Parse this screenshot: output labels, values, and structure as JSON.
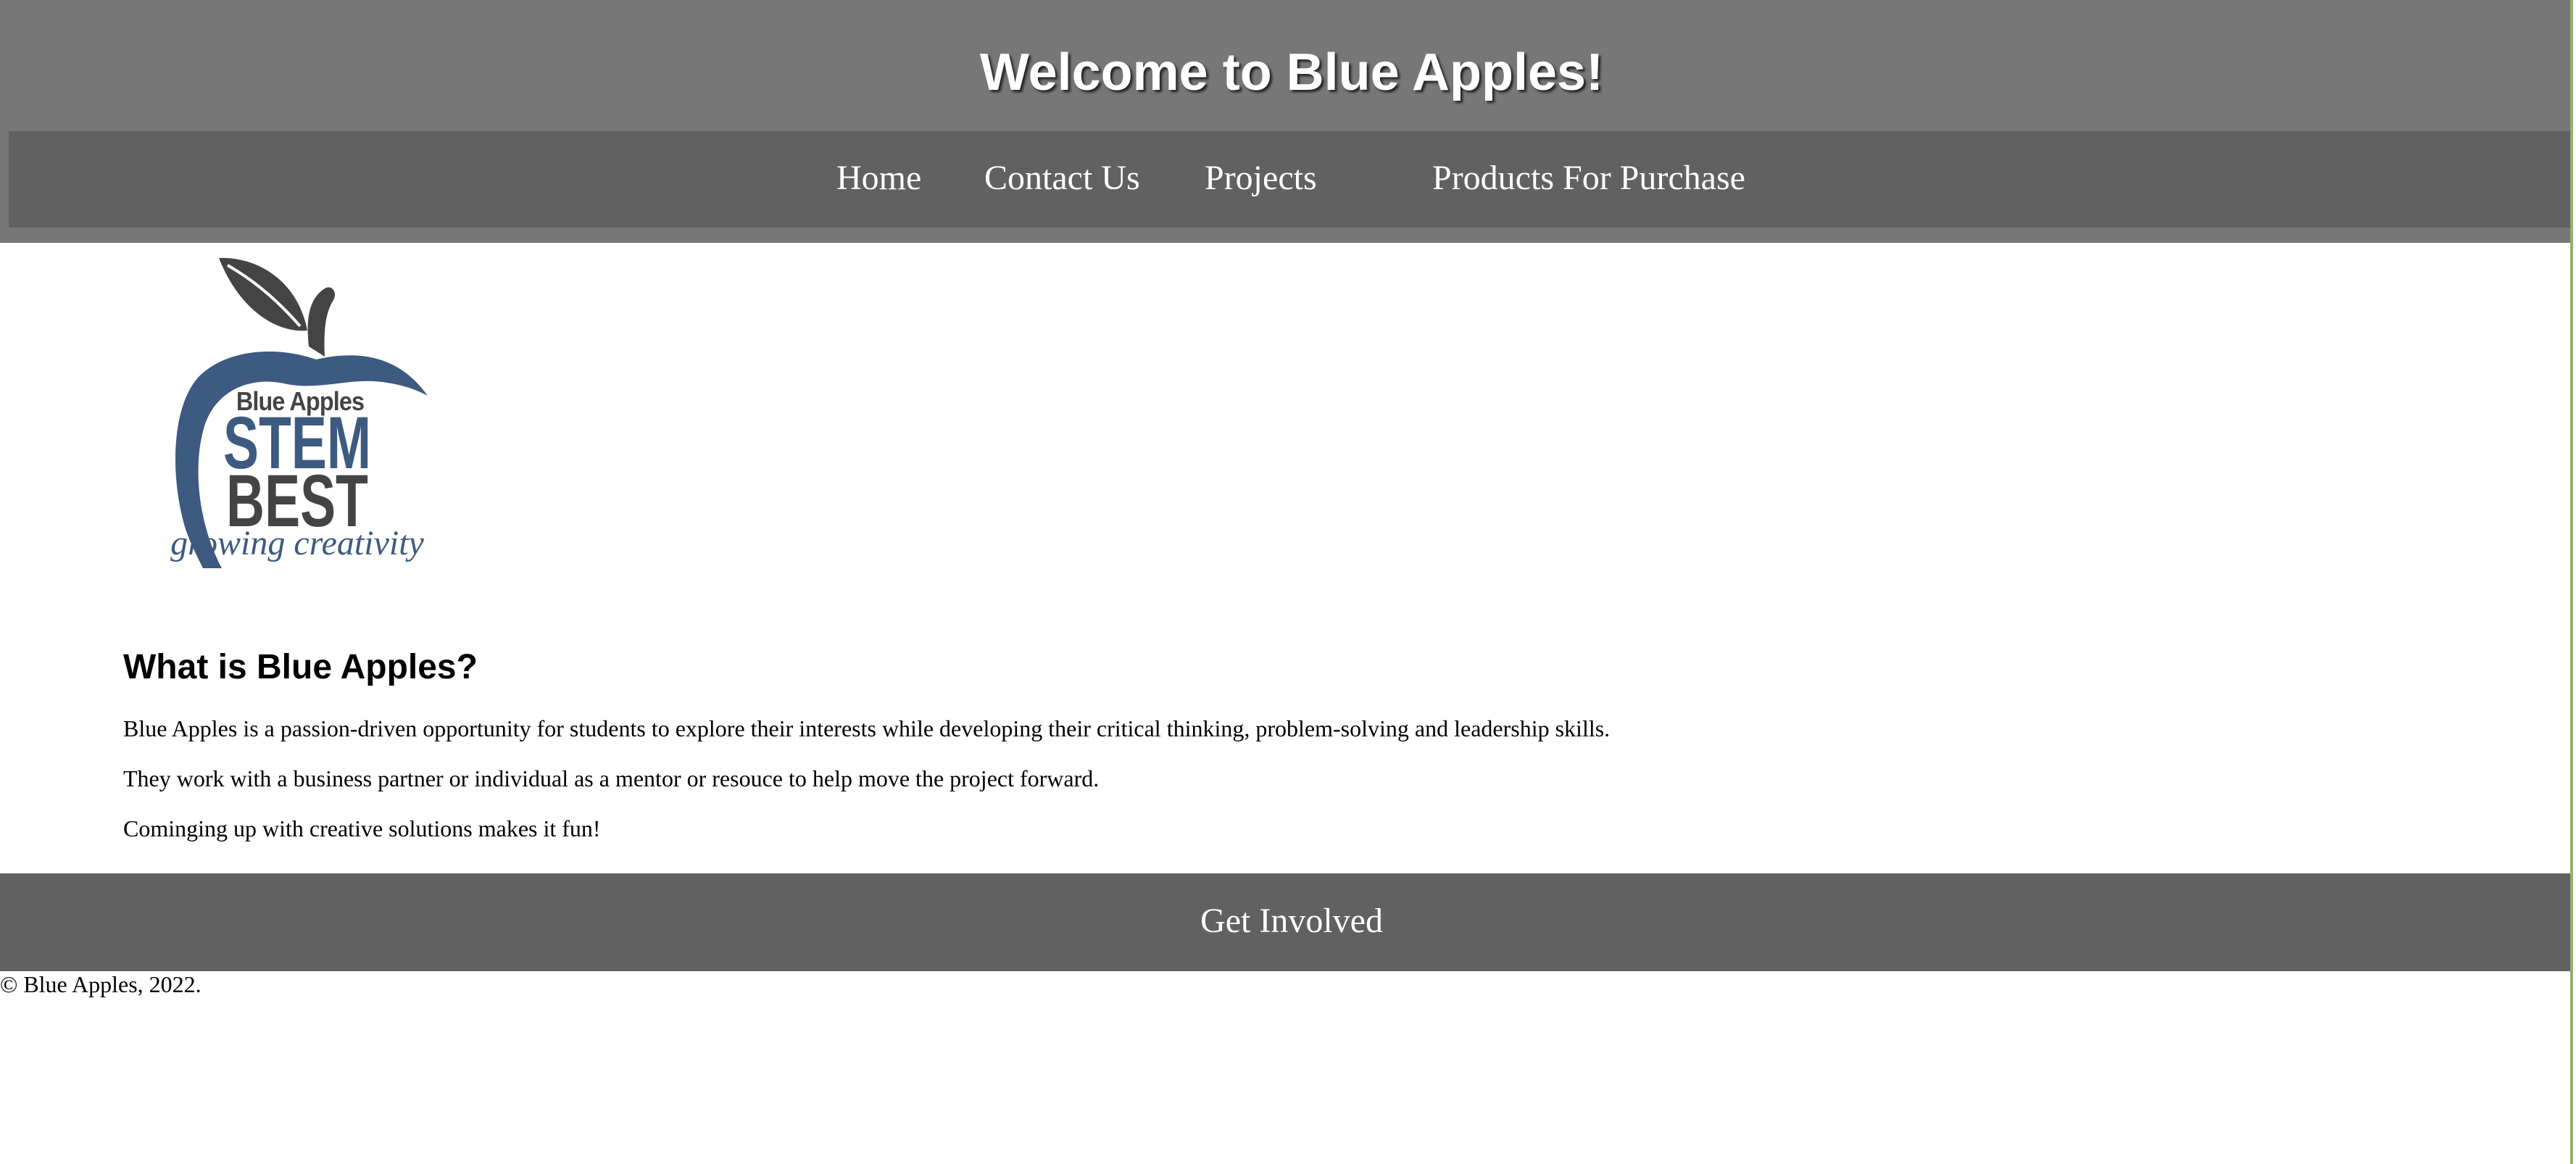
{
  "header": {
    "title": "Welcome to Blue Apples!"
  },
  "nav": {
    "items": [
      {
        "label": "Home"
      },
      {
        "label": "Contact Us"
      },
      {
        "label": "Projects"
      },
      {
        "label": "Products For Purchase"
      }
    ]
  },
  "logo": {
    "line1": "Blue Apples",
    "line2": "STEM",
    "line3": "BEST",
    "tagline": "growing creativity",
    "colors": {
      "blue": "#3d5a80",
      "gray": "#444444"
    }
  },
  "about": {
    "heading": "What is Blue Apples?",
    "paragraphs": [
      "Blue Apples is a passion-driven opportunity for students to explore their interests while developing their critical thinking, problem-solving and leadership skills.",
      "They work with a business partner or individual as a mentor or resouce to help move the project forward.",
      "Cominging up with creative solutions makes it fun!"
    ]
  },
  "cta": {
    "label": "Get Involved"
  },
  "footer": {
    "copyright": "© Blue Apples, 2022."
  },
  "colors": {
    "header_bg": "#777777",
    "nav_bg": "#616161",
    "page_bg": "#ffffff",
    "right_edge": "#8fb174"
  }
}
